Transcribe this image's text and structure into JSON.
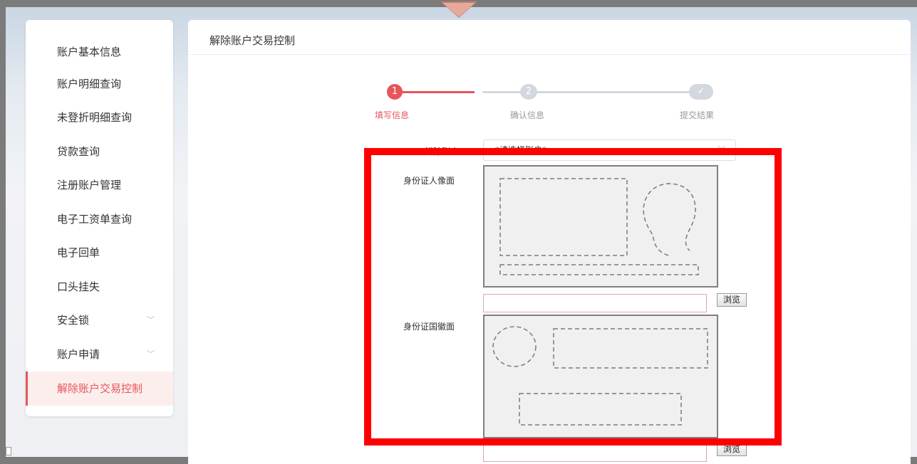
{
  "sidebar": {
    "items": [
      {
        "label": "账户基本信息"
      },
      {
        "label": "账户明细查询"
      },
      {
        "label": "未登折明细查询"
      },
      {
        "label": "贷款查询"
      },
      {
        "label": "注册账户管理"
      },
      {
        "label": "电子工资单查询"
      },
      {
        "label": "电子回单"
      },
      {
        "label": "口头挂失"
      },
      {
        "label": "安全锁",
        "expandable": true
      },
      {
        "label": "账户申请",
        "expandable": true
      },
      {
        "label": "解除账户交易控制",
        "active": true
      }
    ]
  },
  "main": {
    "title": "解除账户交易控制",
    "steps": [
      {
        "number": "1",
        "label": "填写信息",
        "state": "active"
      },
      {
        "number": "2",
        "label": "确认信息",
        "state": "pending"
      },
      {
        "number": "✓",
        "label": "提交结果",
        "state": "pending"
      }
    ],
    "form": {
      "account_label": "解除账户",
      "account_value": "*请选择账户*",
      "id_front_label": "身份证人像面",
      "id_back_label": "身份证国徽面",
      "browse_label": "浏览"
    }
  },
  "colors": {
    "accent": "#e5555b",
    "step_inactive": "#d3d7e0",
    "highlight": "#ff0000"
  },
  "icons": [
    "chevron-down-icon",
    "check-icon"
  ]
}
